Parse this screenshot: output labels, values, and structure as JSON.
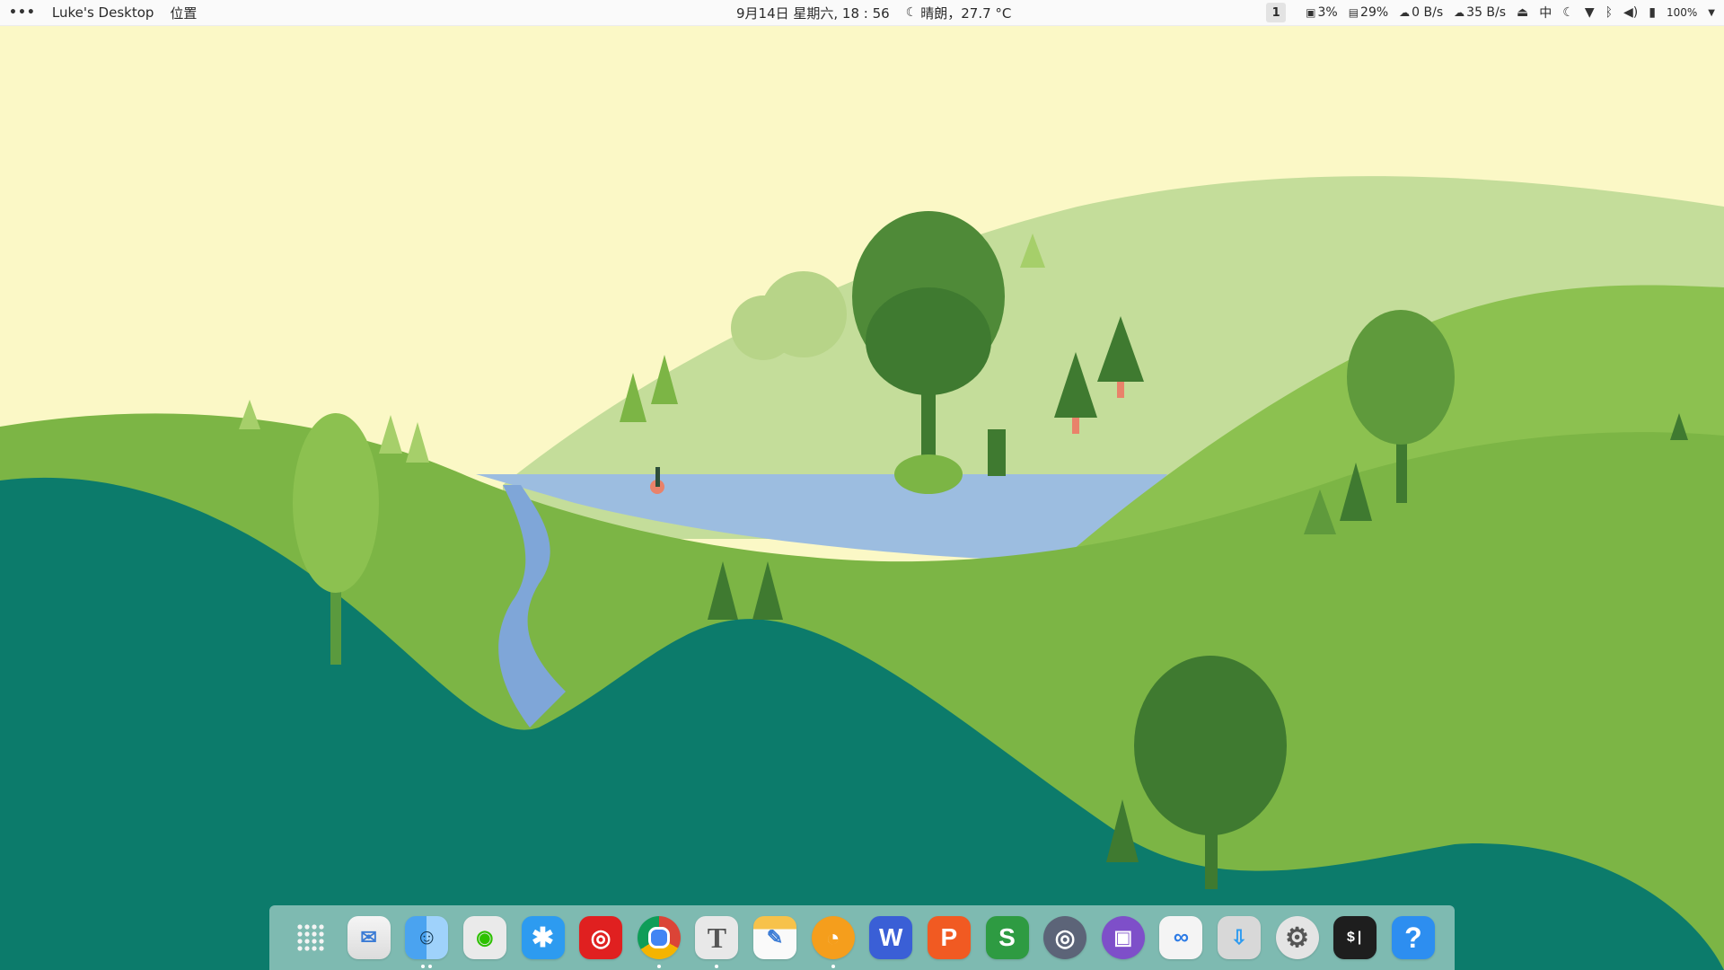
{
  "topbar": {
    "menu_dots": "•••",
    "desktop_name": "Luke's Desktop",
    "location": "位置",
    "datetime": "9月14日 星期六, 18 : 56",
    "weather": "晴朗，27.7 °C",
    "workspace": "1",
    "disk": "3%",
    "memory": "29%",
    "download": "0 B/s",
    "upload": "35 B/s",
    "input_method": "中",
    "battery": "100%"
  },
  "dock": {
    "apps": [
      {
        "name": "app-launcher"
      },
      {
        "name": "mail"
      },
      {
        "name": "finder"
      },
      {
        "name": "wechat"
      },
      {
        "name": "app-store"
      },
      {
        "name": "netease-music"
      },
      {
        "name": "chrome"
      },
      {
        "name": "typora"
      },
      {
        "name": "notes"
      },
      {
        "name": "browser"
      },
      {
        "name": "wps-writer"
      },
      {
        "name": "wps-presentation"
      },
      {
        "name": "wps-spreadsheet"
      },
      {
        "name": "screenshot"
      },
      {
        "name": "calculator"
      },
      {
        "name": "baidu-netdisk"
      },
      {
        "name": "downloader"
      },
      {
        "name": "settings"
      },
      {
        "name": "terminal"
      },
      {
        "name": "help"
      }
    ]
  },
  "colors": {
    "sky": "#fbf8c6",
    "hill_far": "#c4dd9a",
    "hill_mid": "#7cb545",
    "hill_near": "#0c7b6b",
    "lake": "#9cbde0",
    "tree_dark": "#3f7a30"
  }
}
